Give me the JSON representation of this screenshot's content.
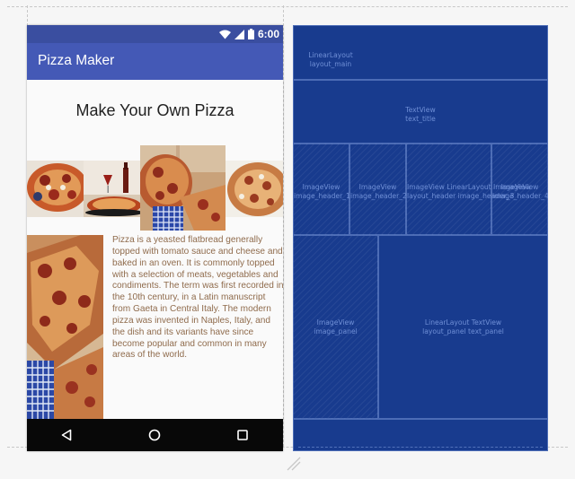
{
  "status_bar": {
    "time": "6:00"
  },
  "app_bar": {
    "title": "Pizza Maker"
  },
  "content": {
    "title": "Make Your Own Pizza",
    "body": "Pizza is a yeasted flatbread generally topped with tomato sauce and cheese and baked in an oven. It is commonly topped with a selection of meats, vegetables and condiments. The term was first recorded in the 10th century, in a Latin manuscript from Gaeta in Central Italy. The modern pizza was invented in Naples, Italy, and the dish and its variants have since become popular and common in many areas of the world."
  },
  "nav_bar": {
    "icons": [
      "back-triangle-icon",
      "home-circle-icon",
      "recents-square-icon"
    ]
  },
  "blueprint": {
    "layout_main": {
      "type": "LinearLayout",
      "id": "layout_main"
    },
    "text_title": {
      "type": "TextView",
      "id": "text_title"
    },
    "header_1": {
      "type": "ImageView",
      "id": "image_header_1"
    },
    "header_2": {
      "type": "ImageView",
      "id": "image_header_2"
    },
    "header_3_overlap": {
      "type": "ImageView LinearLayout ImageView",
      "id": "layout_header image_header_3"
    },
    "header_4": {
      "type": "ImageView",
      "id": "image_header_4"
    },
    "image_panel": {
      "type": "ImageView",
      "id": "image_panel"
    },
    "panel_text": {
      "type": "LinearLayout TextView",
      "id": "layout_panel text_panel"
    }
  },
  "colors": {
    "status_bar": "#3a4ea0",
    "app_bar": "#4459b6",
    "blueprint_bg": "#183b8e",
    "body_text": "#8f6b4c",
    "nav_bar": "#080808"
  }
}
